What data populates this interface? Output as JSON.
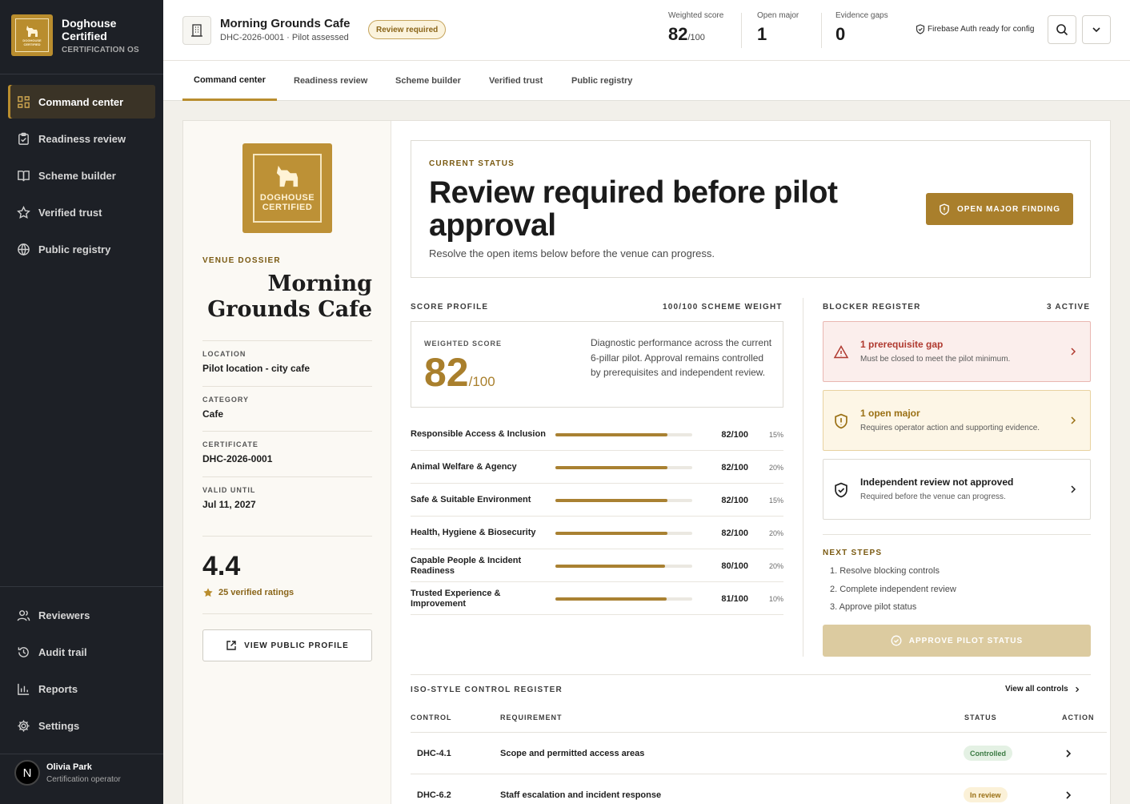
{
  "brand": {
    "name_line1": "Doghouse",
    "name_line2": "Certified",
    "subtitle": "CERTIFICATION OS",
    "logo_line1": "DOGHOUSE",
    "logo_line2": "CERTIFIED"
  },
  "sidebar": {
    "items": [
      {
        "label": "Command center",
        "icon": "grid-icon"
      },
      {
        "label": "Readiness review",
        "icon": "clipboard-check-icon"
      },
      {
        "label": "Scheme builder",
        "icon": "book-icon"
      },
      {
        "label": "Verified trust",
        "icon": "star-icon"
      },
      {
        "label": "Public registry",
        "icon": "globe-icon"
      }
    ],
    "bottom_items": [
      {
        "label": "Reviewers",
        "icon": "users-icon"
      },
      {
        "label": "Audit trail",
        "icon": "history-icon"
      },
      {
        "label": "Reports",
        "icon": "bar-chart-icon"
      },
      {
        "label": "Settings",
        "icon": "gear-icon"
      }
    ],
    "user": {
      "initial": "N",
      "name": "Olivia Park",
      "role": "Certification operator"
    }
  },
  "header": {
    "venue_name": "Morning Grounds Cafe",
    "venue_sub": "DHC-2026-0001 · Pilot assessed",
    "badge": "Review required",
    "metrics": [
      {
        "label": "Weighted score",
        "value": "82",
        "suffix": "/100"
      },
      {
        "label": "Open major",
        "value": "1",
        "suffix": ""
      },
      {
        "label": "Evidence gaps",
        "value": "0",
        "suffix": ""
      }
    ],
    "auth_status": "Firebase Auth ready for config"
  },
  "tabs": [
    "Command center",
    "Readiness review",
    "Scheme builder",
    "Verified trust",
    "Public registry"
  ],
  "dossier": {
    "logo_line1": "DOGHOUSE",
    "logo_line2": "CERTIFIED",
    "kicker": "VENUE DOSSIER",
    "title": "Morning Grounds Cafe",
    "fields": [
      {
        "label": "LOCATION",
        "value": "Pilot location - city cafe"
      },
      {
        "label": "CATEGORY",
        "value": "Cafe"
      },
      {
        "label": "CERTIFICATE",
        "value": "DHC-2026-0001"
      },
      {
        "label": "VALID UNTIL",
        "value": "Jul 11, 2027"
      }
    ],
    "rating": "4.4",
    "rating_count": "25 verified ratings",
    "profile_button": "VIEW PUBLIC PROFILE"
  },
  "status": {
    "kicker": "CURRENT STATUS",
    "title": "Review required before pilot approval",
    "description": "Resolve the open items below before the venue can progress.",
    "button": "OPEN MAJOR FINDING"
  },
  "score_profile": {
    "heading": "SCORE PROFILE",
    "weight_label": "100/100 SCHEME WEIGHT",
    "box_label": "WEIGHTED SCORE",
    "score": "82",
    "score_suffix": "/100",
    "description": "Diagnostic performance across the current 6-pillar pilot. Approval remains controlled by prerequisites and independent review.",
    "pillars": [
      {
        "name": "Responsible Access & Inclusion",
        "score": "82/100",
        "value": 82,
        "weight": "15%"
      },
      {
        "name": "Animal Welfare & Agency",
        "score": "82/100",
        "value": 82,
        "weight": "20%"
      },
      {
        "name": "Safe & Suitable Environment",
        "score": "82/100",
        "value": 82,
        "weight": "15%"
      },
      {
        "name": "Health, Hygiene & Biosecurity",
        "score": "82/100",
        "value": 82,
        "weight": "20%"
      },
      {
        "name": "Capable People & Incident Readiness",
        "score": "80/100",
        "value": 80,
        "weight": "20%"
      },
      {
        "name": "Trusted Experience & Improvement",
        "score": "81/100",
        "value": 81,
        "weight": "10%"
      }
    ]
  },
  "blockers": {
    "heading": "BLOCKER REGISTER",
    "count": "3 ACTIVE",
    "items": [
      {
        "title": "1 prerequisite gap",
        "desc": "Must be closed to meet the pilot minimum.",
        "tone": "danger"
      },
      {
        "title": "1 open major",
        "desc": "Requires operator action and supporting evidence.",
        "tone": "warning"
      },
      {
        "title": "Independent review not approved",
        "desc": "Required before the venue can progress.",
        "tone": "neutral"
      }
    ],
    "next_heading": "NEXT STEPS",
    "next_steps": [
      "1. Resolve blocking controls",
      "2. Complete independent review",
      "3. Approve pilot status"
    ],
    "approve_button": "APPROVE PILOT STATUS"
  },
  "controls": {
    "heading": "ISO-STYLE CONTROL REGISTER",
    "view_all": "View all controls",
    "columns": [
      "CONTROL",
      "REQUIREMENT",
      "STATUS",
      "ACTION"
    ],
    "rows": [
      {
        "code": "DHC-4.1",
        "requirement": "Scope and permitted access areas",
        "status": "Controlled",
        "tone": "ok"
      },
      {
        "code": "DHC-6.2",
        "requirement": "Staff escalation and incident response",
        "status": "In review",
        "tone": "warn"
      }
    ]
  },
  "colors": {
    "accent": "#b98d2e",
    "sidebar": "#1d2026",
    "danger": "#b03a30",
    "warning": "#9a7014"
  }
}
